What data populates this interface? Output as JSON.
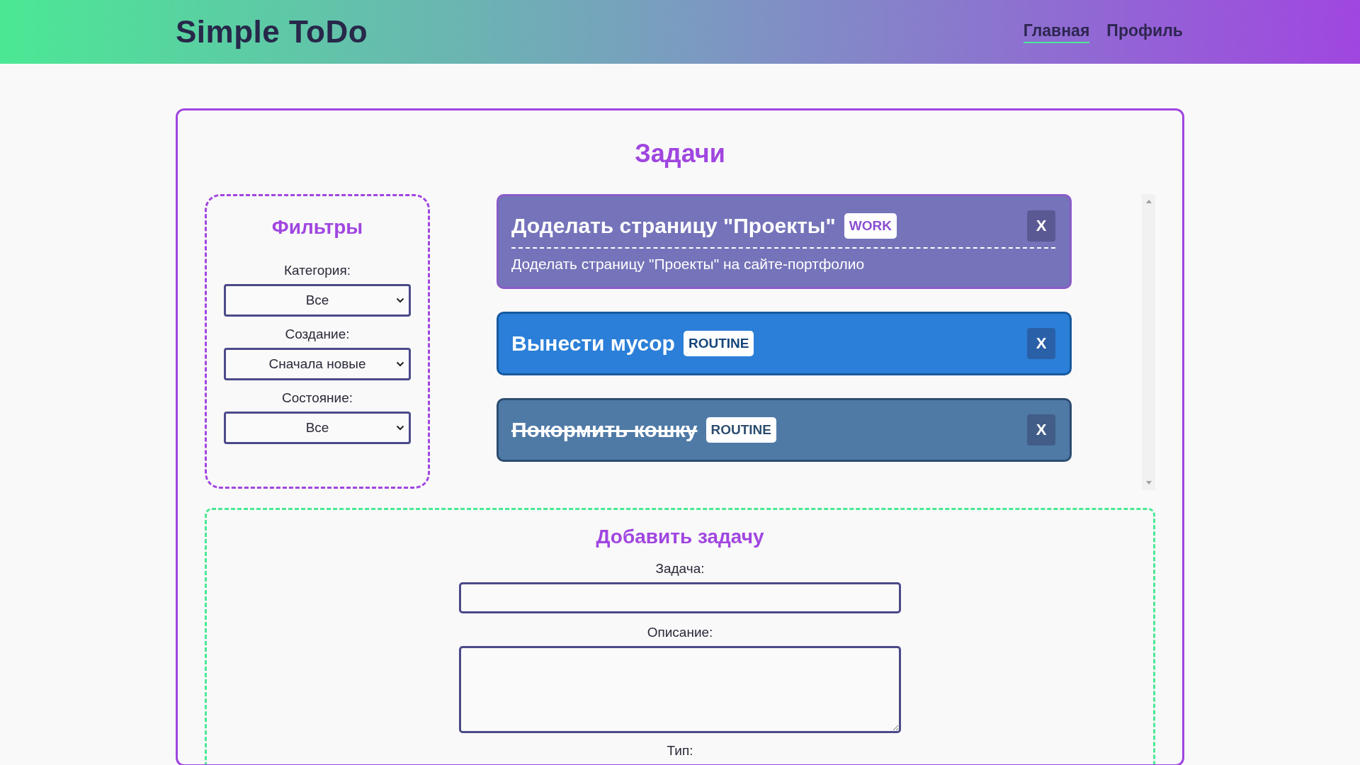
{
  "header": {
    "logo": "Simple ToDo",
    "nav": [
      {
        "label": "Главная",
        "selected": true
      },
      {
        "label": "Профиль",
        "selected": false
      }
    ]
  },
  "page_title": "Задачи",
  "filters": {
    "title": "Фильтры",
    "fields": [
      {
        "label": "Категория:",
        "value": "Все"
      },
      {
        "label": "Создание:",
        "value": "Сначала новые"
      },
      {
        "label": "Состояние:",
        "value": "Все"
      }
    ]
  },
  "tasks": [
    {
      "title": "Доделать страницу \"Проекты\"",
      "kind": "work",
      "tag": "WORK",
      "done": false,
      "description": "Доделать страницу \"Проекты\" на сайте-портфолио",
      "delete": "X"
    },
    {
      "title": "Вынести мусор",
      "kind": "routine",
      "tag": "ROUTINE",
      "done": false,
      "delete": "X"
    },
    {
      "title": "Покормить кошку",
      "kind": "routine",
      "tag": "ROUTINE",
      "done": true,
      "delete": "X"
    }
  ],
  "add_form": {
    "title": "Добавить задачу",
    "task_label": "Задача:",
    "description_label": "Описание:",
    "type_label": "Тип:"
  }
}
